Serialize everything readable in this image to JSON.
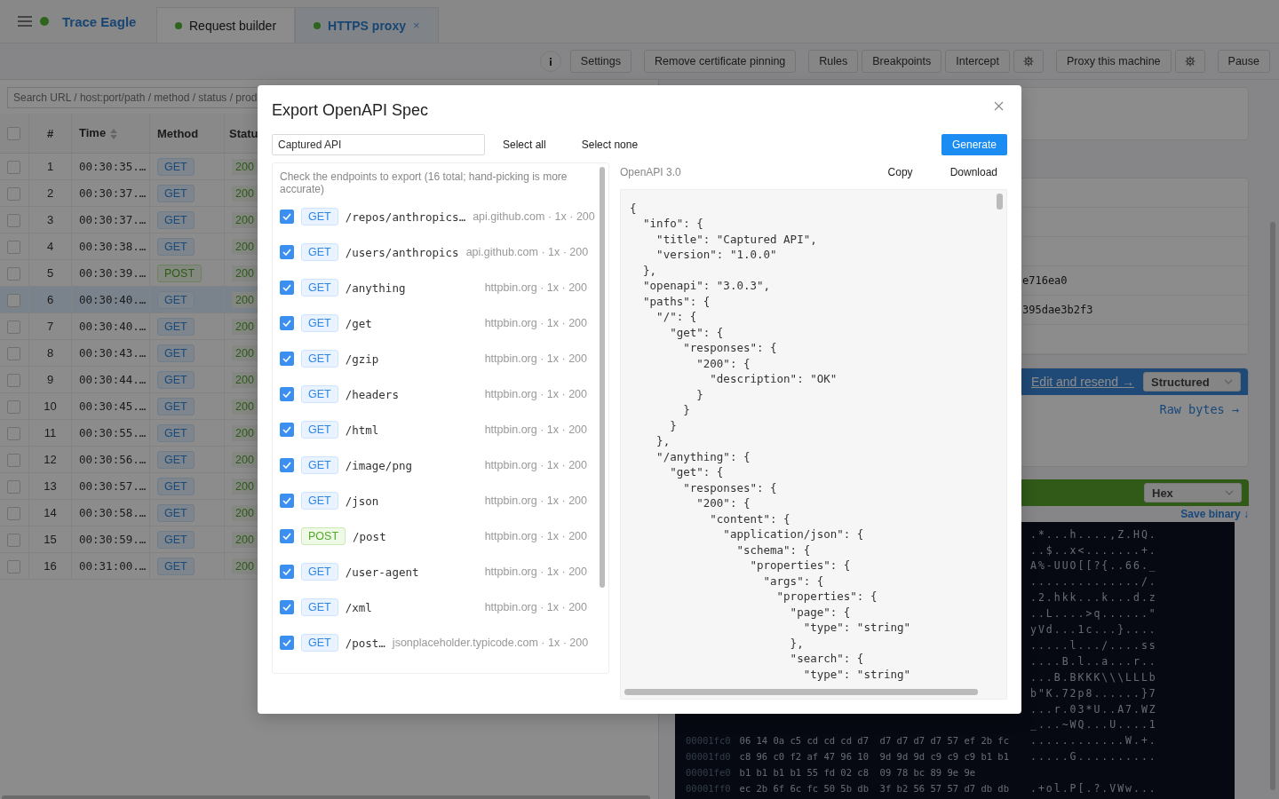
{
  "app": {
    "name": "Trace Eagle"
  },
  "tabs": [
    {
      "label": "Request builder",
      "selected": false
    },
    {
      "label": "HTTPS proxy",
      "selected": true,
      "close": "×"
    }
  ],
  "toolbar": [
    {
      "kind": "info"
    },
    {
      "kind": "text",
      "label": "Settings"
    },
    {
      "kind": "text",
      "label": "Remove certificate pinning"
    },
    {
      "kind": "text",
      "label": "Rules"
    },
    {
      "kind": "text",
      "label": "Breakpoints"
    },
    {
      "kind": "text",
      "label": "Intercept"
    },
    {
      "kind": "gear"
    },
    {
      "kind": "text",
      "label": "Proxy this machine"
    },
    {
      "kind": "gear"
    },
    {
      "kind": "text",
      "label": "Pause"
    }
  ],
  "search": {
    "placeholder": "Search URL / host:port/path / method / status / prod"
  },
  "table": {
    "select_all_checked": false,
    "columns": [
      {
        "label": "#"
      },
      {
        "label": "Time",
        "sortable": true
      },
      {
        "label": "Method"
      },
      {
        "label": "Statu"
      }
    ],
    "rows": [
      {
        "number": "1",
        "time": "00:30:35.…",
        "method": "GET",
        "kind": "get",
        "status": "200",
        "checked": false,
        "selected": false
      },
      {
        "number": "2",
        "time": "00:30:37.…",
        "method": "GET",
        "kind": "get",
        "status": "200",
        "checked": false,
        "selected": false
      },
      {
        "number": "3",
        "time": "00:30:37.…",
        "method": "GET",
        "kind": "get",
        "status": "200",
        "checked": false,
        "selected": false
      },
      {
        "number": "4",
        "time": "00:30:38.…",
        "method": "GET",
        "kind": "get",
        "status": "200",
        "checked": false,
        "selected": false
      },
      {
        "number": "5",
        "time": "00:30:39.…",
        "method": "POST",
        "kind": "post",
        "status": "200",
        "checked": false,
        "selected": false
      },
      {
        "number": "6",
        "time": "00:30:40.…",
        "method": "GET",
        "kind": "get",
        "status": "200",
        "checked": false,
        "selected": true
      },
      {
        "number": "7",
        "time": "00:30:40.…",
        "method": "GET",
        "kind": "get",
        "status": "200",
        "checked": false,
        "selected": false
      },
      {
        "number": "8",
        "time": "00:30:43.…",
        "method": "GET",
        "kind": "get",
        "status": "200",
        "checked": false,
        "selected": false
      },
      {
        "number": "9",
        "time": "00:30:44.…",
        "method": "GET",
        "kind": "get",
        "status": "200",
        "checked": false,
        "selected": false
      },
      {
        "number": "10",
        "time": "00:30:45.…",
        "method": "GET",
        "kind": "get",
        "status": "200",
        "checked": false,
        "selected": false
      },
      {
        "number": "11",
        "time": "00:30:55.…",
        "method": "GET",
        "kind": "get",
        "status": "200",
        "checked": false,
        "selected": false
      },
      {
        "number": "12",
        "time": "00:30:56.…",
        "method": "GET",
        "kind": "get",
        "status": "200",
        "checked": false,
        "selected": false
      },
      {
        "number": "13",
        "time": "00:30:57.…",
        "method": "GET",
        "kind": "get",
        "status": "200",
        "checked": false,
        "selected": false
      },
      {
        "number": "14",
        "time": "00:30:58.…",
        "method": "GET",
        "kind": "get",
        "status": "200",
        "checked": false,
        "selected": false
      },
      {
        "number": "15",
        "time": "00:30:59.…",
        "method": "GET",
        "kind": "get",
        "status": "200",
        "checked": false,
        "selected": false
      },
      {
        "number": "16",
        "time": "00:31:00.…",
        "method": "GET",
        "kind": "get",
        "status": "200",
        "checked": false,
        "selected": false
      }
    ]
  },
  "detail": {
    "values": [
      "e716ea0",
      "395dae3b2f3"
    ],
    "request_bar": {
      "link": "Edit and resend →",
      "select": "Structured"
    },
    "raw_link": "Raw bytes →",
    "response_bar": {
      "select": "Hex"
    },
    "save_link": "Save binary ↓",
    "hex_rows": [
      {
        "ascii": ".*...h....,Z.HQ."
      },
      {
        "ascii": "..$..x<.......+."
      },
      {
        "ascii": "A%-UUO[[?{..66._"
      },
      {
        "ascii": "............../."
      },
      {
        "ascii": ".2.hkk...k...d.z"
      },
      {
        "ascii": "..L....>q......\""
      },
      {
        "ascii": "yVd...1c...}...."
      },
      {
        "ascii": ".....l.../....ss"
      },
      {
        "ascii": "....B.l..a...r.."
      },
      {
        "ascii": "...B.BKKK\\\\\\LLLb"
      },
      {
        "ascii": "b\"K.72p8......}7"
      },
      {
        "ascii": "...r.03*U..A7.WZ"
      },
      {
        "ascii": "_...~WQ...U....1"
      },
      {
        "offset": "00001fc0",
        "hex": "06 14 0a c5 cd cd cd d7  d7 d7 d7 d7 57 ef 2b fc",
        "ascii": "............W.+."
      },
      {
        "offset": "00001fd0",
        "hex": "c8 96 c0 f2 af 47 96 10  9d 9d 9d c9 c9 c9 b1 b1",
        "ascii": ".....G.........."
      },
      {
        "offset": "00001fe0",
        "hex": "b1 b1 b1 b1 55 fd 02 c8  09 78 bc 89 9e 9e"
      },
      {
        "offset": "00001ff0",
        "hex": "ec 2b 6f 6c fc 50 5b db  3f b2 56 57 57 d7 db db",
        "ascii": ".+ol.P[.?.VWw..."
      }
    ]
  },
  "modal": {
    "title": "Export OpenAPI Spec",
    "name_field": {
      "value": "Captured API"
    },
    "select_all": "Select all",
    "select_none": "Select none",
    "generate": "Generate",
    "hint": "Check the endpoints to export (16 total; hand-picking is more accurate)",
    "endpoints": [
      {
        "checked": true,
        "method": "GET",
        "kind": "get",
        "path": "/repos/anthropics…",
        "meta": "api.github.com · 1x · 200"
      },
      {
        "checked": true,
        "method": "GET",
        "kind": "get",
        "path": "/users/anthropics",
        "meta": "api.github.com · 1x · 200"
      },
      {
        "checked": true,
        "method": "GET",
        "kind": "get",
        "path": "/anything",
        "meta": "httpbin.org · 1x · 200"
      },
      {
        "checked": true,
        "method": "GET",
        "kind": "get",
        "path": "/get",
        "meta": "httpbin.org · 1x · 200"
      },
      {
        "checked": true,
        "method": "GET",
        "kind": "get",
        "path": "/gzip",
        "meta": "httpbin.org · 1x · 200"
      },
      {
        "checked": true,
        "method": "GET",
        "kind": "get",
        "path": "/headers",
        "meta": "httpbin.org · 1x · 200"
      },
      {
        "checked": true,
        "method": "GET",
        "kind": "get",
        "path": "/html",
        "meta": "httpbin.org · 1x · 200"
      },
      {
        "checked": true,
        "method": "GET",
        "kind": "get",
        "path": "/image/png",
        "meta": "httpbin.org · 1x · 200"
      },
      {
        "checked": true,
        "method": "GET",
        "kind": "get",
        "path": "/json",
        "meta": "httpbin.org · 1x · 200"
      },
      {
        "checked": true,
        "method": "POST",
        "kind": "post",
        "path": "/post",
        "meta": "httpbin.org · 1x · 200"
      },
      {
        "checked": true,
        "method": "GET",
        "kind": "get",
        "path": "/user-agent",
        "meta": "httpbin.org · 1x · 200"
      },
      {
        "checked": true,
        "method": "GET",
        "kind": "get",
        "path": "/xml",
        "meta": "httpbin.org · 1x · 200"
      },
      {
        "checked": true,
        "method": "GET",
        "kind": "get",
        "path": "/post…",
        "meta": "jsonplaceholder.typicode.com · 1x · 200"
      }
    ],
    "spec_label": "OpenAPI 3.0",
    "copy": "Copy",
    "download": "Download",
    "code": "{\n  \"info\": {\n    \"title\": \"Captured API\",\n    \"version\": \"1.0.0\"\n  },\n  \"openapi\": \"3.0.3\",\n  \"paths\": {\n    \"/\": {\n      \"get\": {\n        \"responses\": {\n          \"200\": {\n            \"description\": \"OK\"\n          }\n        }\n      }\n    },\n    \"/anything\": {\n      \"get\": {\n        \"responses\": {\n          \"200\": {\n            \"content\": {\n              \"application/json\": {\n                \"schema\": {\n                  \"properties\": {\n                    \"args\": {\n                      \"properties\": {\n                        \"page\": {\n                          \"type\": \"string\"\n                        },\n                        \"search\": {\n                          \"type\": \"string\""
  }
}
